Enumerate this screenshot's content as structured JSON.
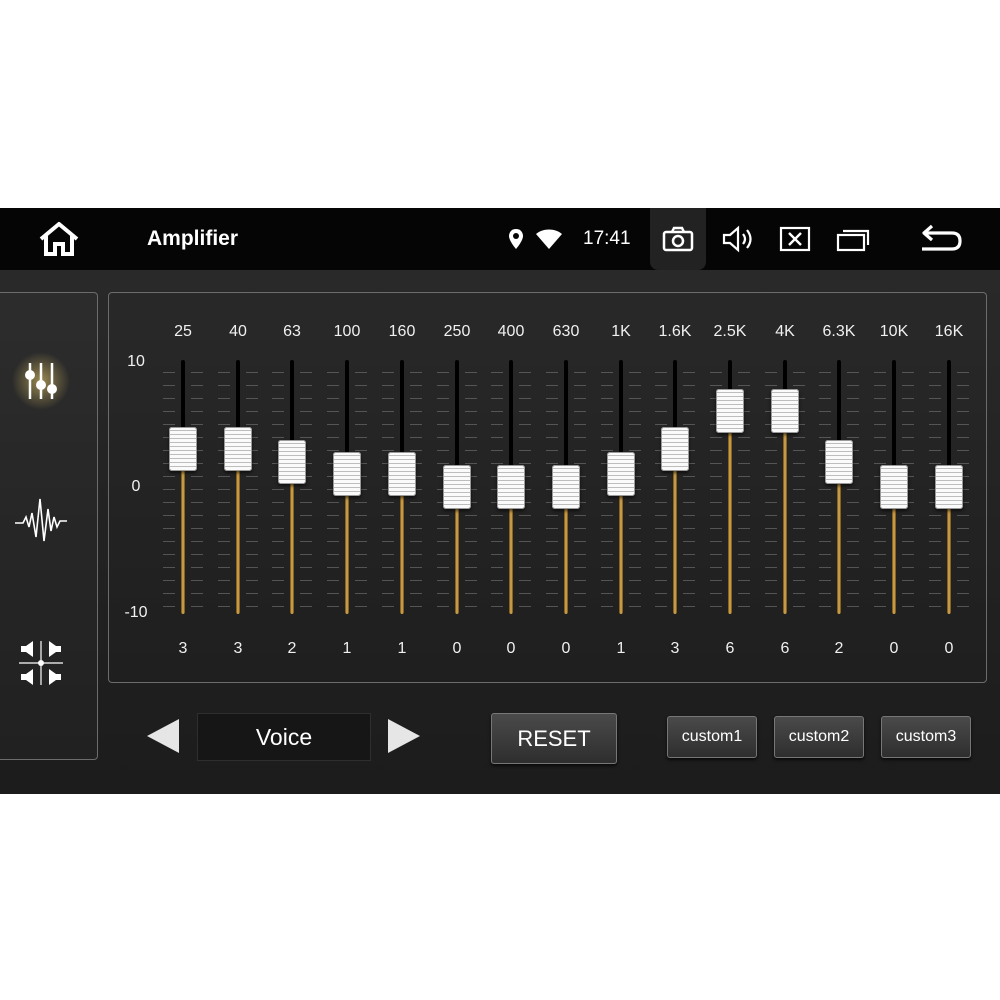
{
  "header": {
    "title": "Amplifier",
    "time": "17:41",
    "icons": [
      "home-icon",
      "location-icon",
      "wifi-icon",
      "camera-icon",
      "volume-icon",
      "close-window-icon",
      "recent-apps-icon",
      "back-icon"
    ]
  },
  "side_menu": {
    "items": [
      {
        "name": "equalizer",
        "icon": "equalizer-sliders-icon",
        "active": true
      },
      {
        "name": "sound-effect",
        "icon": "waveform-icon",
        "active": false
      },
      {
        "name": "balance",
        "icon": "speaker-balance-icon",
        "active": false
      }
    ]
  },
  "equalizer": {
    "scale_labels": [
      "10",
      "0",
      "-10"
    ],
    "range": [
      -10,
      10
    ],
    "bands": [
      {
        "freq": "25",
        "value": 3
      },
      {
        "freq": "40",
        "value": 3
      },
      {
        "freq": "63",
        "value": 2
      },
      {
        "freq": "100",
        "value": 1
      },
      {
        "freq": "160",
        "value": 1
      },
      {
        "freq": "250",
        "value": 0
      },
      {
        "freq": "400",
        "value": 0
      },
      {
        "freq": "630",
        "value": 0
      },
      {
        "freq": "1K",
        "value": 1
      },
      {
        "freq": "1.6K",
        "value": 3
      },
      {
        "freq": "2.5K",
        "value": 6
      },
      {
        "freq": "4K",
        "value": 6
      },
      {
        "freq": "6.3K",
        "value": 2
      },
      {
        "freq": "10K",
        "value": 0
      },
      {
        "freq": "16K",
        "value": 0
      }
    ]
  },
  "controls": {
    "preset_name": "Voice",
    "reset_label": "RESET",
    "custom_labels": [
      "custom1",
      "custom2",
      "custom3"
    ]
  },
  "colors": {
    "accent": "#e2b35a",
    "active_icon_glow": "#f5d76e"
  }
}
